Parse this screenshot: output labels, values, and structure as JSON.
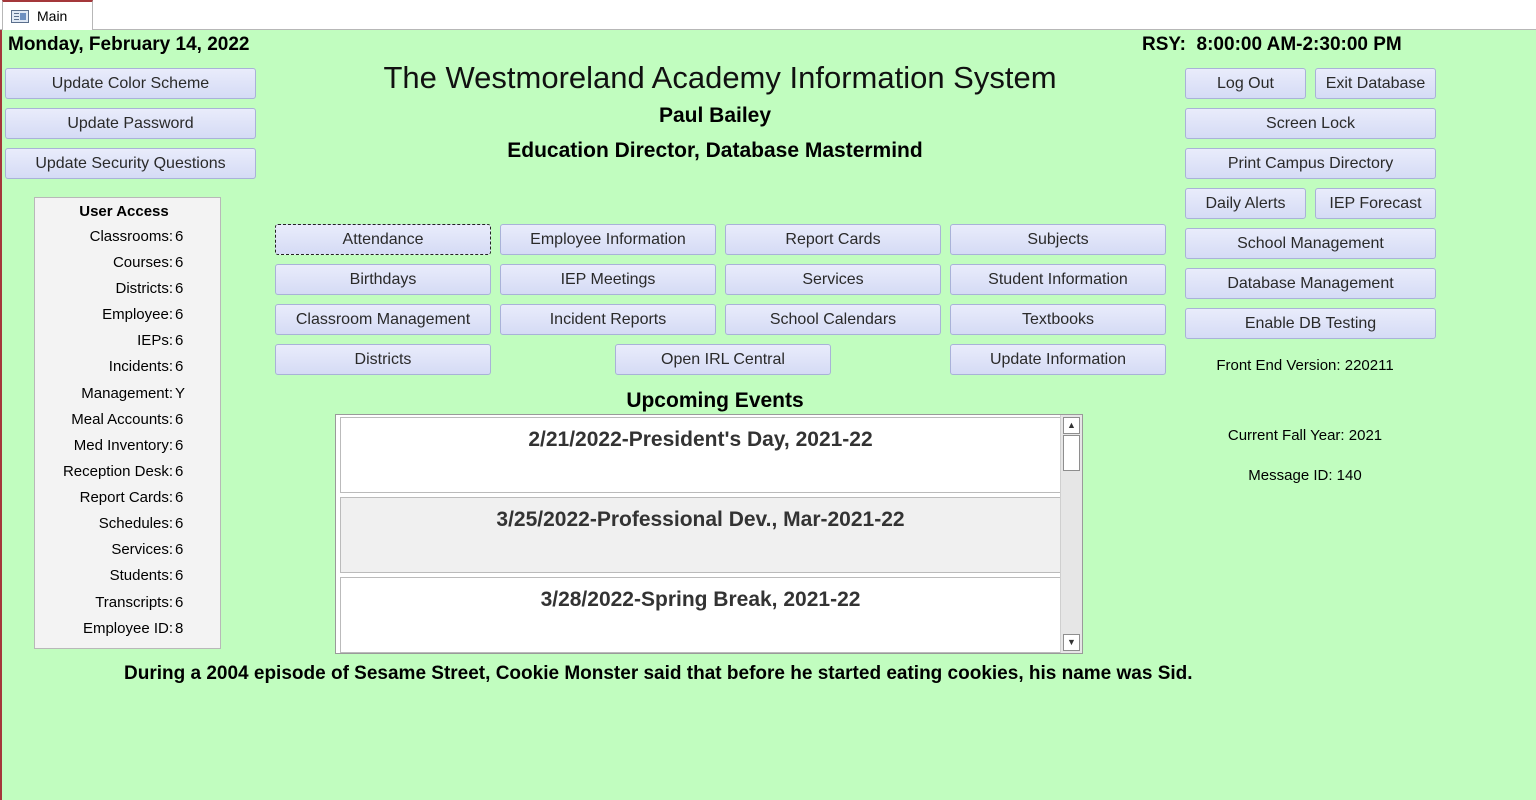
{
  "tab": {
    "label": "Main"
  },
  "header": {
    "date": "Monday, February 14, 2022",
    "rsy": "RSY:  8:00:00 AM-2:30:00 PM",
    "title": "The Westmoreland Academy Information System",
    "user_name": "Paul Bailey",
    "user_role": "Education Director, Database Mastermind"
  },
  "left_buttons": {
    "color_scheme": "Update Color Scheme",
    "password": "Update Password",
    "security": "Update Security Questions"
  },
  "user_access": {
    "title": "User Access",
    "rows": [
      {
        "label": "Classrooms:",
        "value": "6"
      },
      {
        "label": "Courses:",
        "value": "6"
      },
      {
        "label": "Districts:",
        "value": "6"
      },
      {
        "label": "Employee:",
        "value": "6"
      },
      {
        "label": "IEPs:",
        "value": "6"
      },
      {
        "label": "Incidents:",
        "value": "6"
      },
      {
        "label": "Management:",
        "value": "Y"
      },
      {
        "label": "Meal Accounts:",
        "value": "6"
      },
      {
        "label": "Med Inventory:",
        "value": "6"
      },
      {
        "label": "Reception Desk:",
        "value": "6"
      },
      {
        "label": "Report Cards:",
        "value": "6"
      },
      {
        "label": "Schedules:",
        "value": "6"
      },
      {
        "label": "Services:",
        "value": "6"
      },
      {
        "label": "Students:",
        "value": "6"
      },
      {
        "label": "Transcripts:",
        "value": "6"
      },
      {
        "label": "Employee ID:",
        "value": "8"
      }
    ]
  },
  "main_buttons": {
    "attendance": "Attendance",
    "employee_info": "Employee Information",
    "report_cards": "Report Cards",
    "subjects": "Subjects",
    "birthdays": "Birthdays",
    "iep_meetings": "IEP Meetings",
    "services": "Services",
    "student_info": "Student Information",
    "classroom_mgmt": "Classroom Management",
    "incident_reports": "Incident Reports",
    "school_calendars": "School Calendars",
    "textbooks": "Textbooks",
    "districts": "Districts",
    "open_irl": "Open IRL Central",
    "update_info": "Update Information"
  },
  "right_buttons": {
    "log_out": "Log Out",
    "exit_db": "Exit Database",
    "screen_lock": "Screen Lock",
    "print_directory": "Print Campus Directory",
    "daily_alerts": "Daily Alerts",
    "iep_forecast": "IEP Forecast",
    "school_mgmt": "School Management",
    "db_mgmt": "Database Management",
    "db_testing": "Enable DB Testing"
  },
  "info": {
    "front_end_version": "Front End Version: 220211",
    "fall_year": "Current Fall Year: 2021",
    "message_id": "Message ID: 140"
  },
  "events": {
    "title": "Upcoming Events",
    "items": [
      "2/21/2022-President's Day, 2021-22",
      "3/25/2022-Professional Dev., Mar-2021-22",
      "3/28/2022-Spring Break, 2021-22"
    ]
  },
  "trivia": "During a 2004 episode of Sesame Street, Cookie Monster said that before he started eating cookies, his name was Sid."
}
